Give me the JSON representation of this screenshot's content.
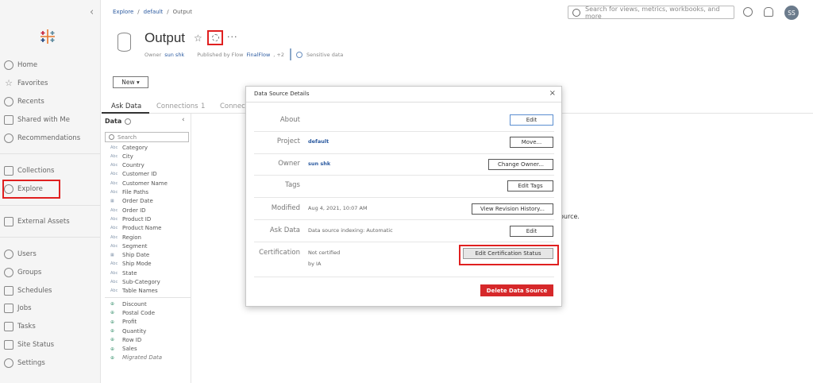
{
  "sidebar": {
    "items": [
      {
        "label": "Home",
        "icon": "home-icon"
      },
      {
        "label": "Favorites",
        "icon": "star-icon"
      },
      {
        "label": "Recents",
        "icon": "clock-icon"
      },
      {
        "label": "Shared with Me",
        "icon": "shared-icon"
      },
      {
        "label": "Recommendations",
        "icon": "lightbulb-icon"
      },
      {
        "label": "Collections",
        "icon": "collections-icon"
      },
      {
        "label": "Explore",
        "icon": "compass-icon"
      },
      {
        "label": "External Assets",
        "icon": "external-assets-icon"
      },
      {
        "label": "Users",
        "icon": "users-icon"
      },
      {
        "label": "Groups",
        "icon": "groups-icon"
      },
      {
        "label": "Schedules",
        "icon": "calendar-icon"
      },
      {
        "label": "Jobs",
        "icon": "jobs-icon"
      },
      {
        "label": "Tasks",
        "icon": "tasks-icon"
      },
      {
        "label": "Site Status",
        "icon": "site-status-icon"
      },
      {
        "label": "Settings",
        "icon": "gear-icon"
      }
    ]
  },
  "breadcrumb": {
    "root": "Explore",
    "sep1": "/",
    "project": "default",
    "sep2": "/",
    "current": "Output"
  },
  "search": {
    "placeholder": "Search for views, metrics, workbooks, and more"
  },
  "user": {
    "initials": "SS"
  },
  "header": {
    "title": "Output",
    "owner_label": "Owner",
    "owner": "sun shk",
    "published_label": "Published by Flow",
    "flow": "FinalFlow",
    "extra": ", +2",
    "sensitive": "Sensitive data",
    "new_button": "New ▾"
  },
  "tabs": [
    {
      "label": "Ask Data"
    },
    {
      "label": "Connections"
    },
    {
      "label": "1"
    },
    {
      "label": "Connec"
    }
  ],
  "data_panel": {
    "title": "Data",
    "search_placeholder": "Search",
    "dimensions": [
      {
        "type": "Abc",
        "name": "Category"
      },
      {
        "type": "Abc",
        "name": "City"
      },
      {
        "type": "Abc",
        "name": "Country"
      },
      {
        "type": "Abc",
        "name": "Customer ID"
      },
      {
        "type": "Abc",
        "name": "Customer Name"
      },
      {
        "type": "Abc",
        "name": "File Paths"
      },
      {
        "type": "date",
        "name": "Order Date"
      },
      {
        "type": "Abc",
        "name": "Order ID"
      },
      {
        "type": "Abc",
        "name": "Product ID"
      },
      {
        "type": "Abc",
        "name": "Product Name"
      },
      {
        "type": "Abc",
        "name": "Region"
      },
      {
        "type": "Abc",
        "name": "Segment"
      },
      {
        "type": "date",
        "name": "Ship Date"
      },
      {
        "type": "Abc",
        "name": "Ship Mode"
      },
      {
        "type": "Abc",
        "name": "State"
      },
      {
        "type": "Abc",
        "name": "Sub-Category"
      },
      {
        "type": "Abc",
        "name": "Table Names"
      }
    ],
    "measures": [
      {
        "type": "#",
        "name": "Discount"
      },
      {
        "type": "#",
        "name": "Postal Code"
      },
      {
        "type": "#",
        "name": "Profit"
      },
      {
        "type": "#",
        "name": "Quantity"
      },
      {
        "type": "#",
        "name": "Row ID"
      },
      {
        "type": "#",
        "name": "Sales"
      },
      {
        "type": "#",
        "name": "Migrated Data"
      }
    ]
  },
  "background_text": "ource.",
  "modal": {
    "title": "Data Source Details",
    "close": "×",
    "rows": {
      "about": {
        "label": "About",
        "button": "Edit"
      },
      "project": {
        "label": "Project",
        "value": "default",
        "button": "Move..."
      },
      "owner": {
        "label": "Owner",
        "value": "sun shk",
        "button": "Change Owner..."
      },
      "tags": {
        "label": "Tags",
        "button": "Edit Tags"
      },
      "modified": {
        "label": "Modified",
        "value": "Aug 4, 2021, 10:07 AM",
        "button": "View Revision History..."
      },
      "askdata": {
        "label": "Ask Data",
        "value": "Data source indexing: Automatic",
        "button": "Edit"
      },
      "certification": {
        "label": "Certification",
        "value": "Not certified",
        "value2": "by IA",
        "button": "Edit Certification Status"
      }
    },
    "delete_button": "Delete Data Source"
  },
  "colors": {
    "accent_red": "#e02020",
    "delete_red": "#d6282a",
    "link_blue": "#2b5aa0"
  }
}
